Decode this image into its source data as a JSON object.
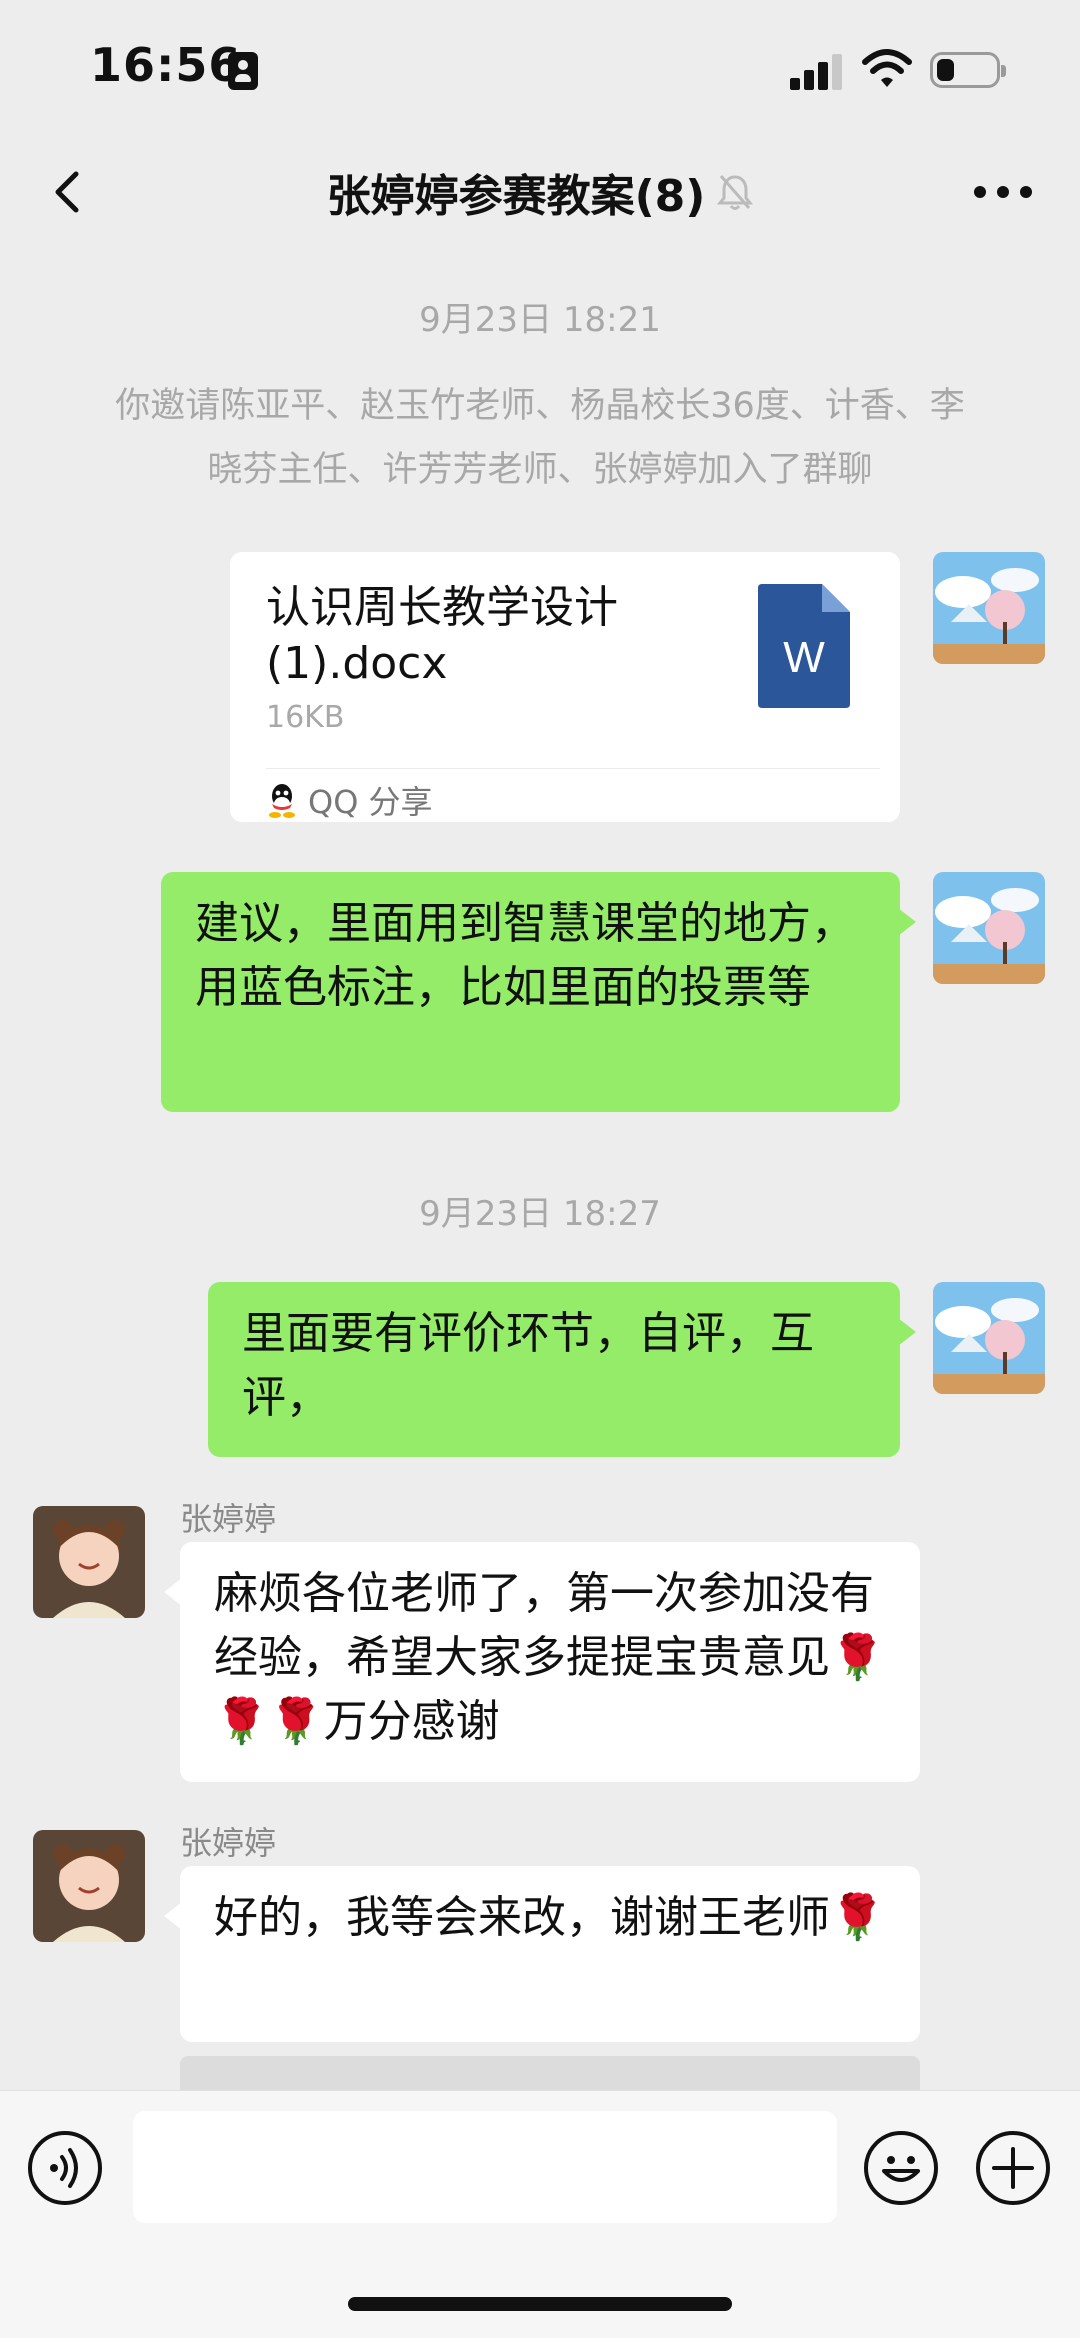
{
  "status_bar": {
    "time": "16:56",
    "battery_level": 0.3
  },
  "header": {
    "title": "张婷婷参赛教案(8)",
    "muted": true
  },
  "messages": {
    "ts1": "9月23日 18:21",
    "system": "你邀请陈亚平、赵玉竹老师、杨晶校长36度、计香、李晓芬主任、许芳芳老师、张婷婷加入了群聊",
    "file": {
      "name": "认识周长教学设计(1).docx",
      "size": "16KB",
      "source": "QQ 分享",
      "icon_letter": "W"
    },
    "msg1": "建议，里面用到智慧课堂的地方，用蓝色标注，比如里面的投票等",
    "ts2": "9月23日 18:27",
    "msg2": "里面要有评价环节，自评，互评，",
    "sender1": "张婷婷",
    "msg3": "麻烦各位老师了，第一次参加没有经验，希望大家多提提宝贵意见🌹🌹🌹万分感谢",
    "sender2": "张婷婷",
    "msg4": "好的，我等会来改，谢谢王老师🌹",
    "quote_partial": "..."
  },
  "colors": {
    "bg": "#ededed",
    "sent_bubble": "#95ec69",
    "recv_bubble": "#ffffff",
    "word_icon": "#2b579a"
  },
  "icons": [
    "back-arrow",
    "mute-bell",
    "more-dots",
    "voice",
    "emoji",
    "plus"
  ]
}
